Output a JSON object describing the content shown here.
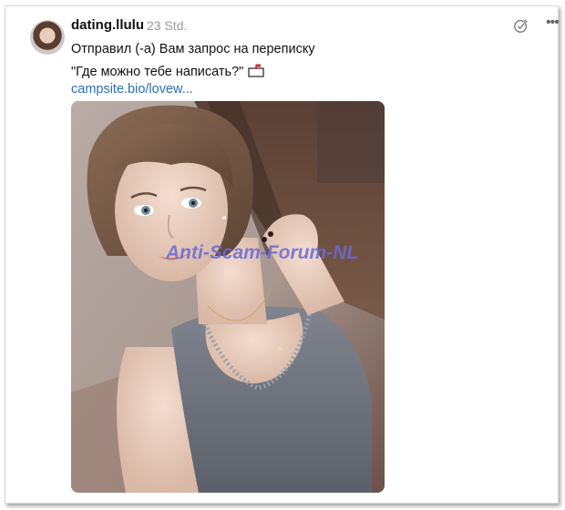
{
  "post": {
    "username": "dating.llulu",
    "time": "23 Std.",
    "text_line1": "Отправил (-а) Вам запрос на переписку",
    "text_line2": "\"Где можно тебе написать?\"",
    "link": "campsite.bio/lovew..."
  },
  "icons": {
    "action": "edit-check-icon",
    "more": "more-icon",
    "inline": "mailbox-icon"
  },
  "watermark": {
    "text": "Anti-Scam-Forum-NL"
  },
  "colors": {
    "link": "#2a6fb5",
    "watermark": "#6a6ad8",
    "time": "#9a9a9a"
  }
}
